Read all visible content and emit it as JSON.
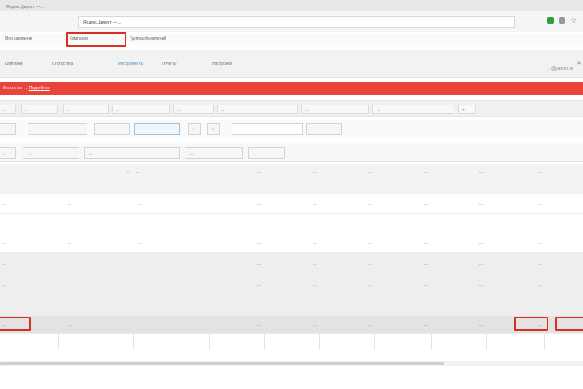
{
  "browser": {
    "tab_title": "Яндекс.Директ — ...",
    "address": "Яндекс.Директ — ...",
    "icons": [
      "secure-icon",
      "extension-icon",
      "bookmark-star-icon"
    ]
  },
  "breadcrumbs": {
    "items": [
      "Мои кампании",
      "Кампания",
      "Группа объявлений"
    ]
  },
  "nav": {
    "items": [
      "Кампании",
      "Статистика",
      "Инструменты",
      "Отчёты",
      "Настройки"
    ],
    "active_index": 2,
    "account_line1": "...",
    "account_line2": "...@yandex.ru"
  },
  "notice": {
    "text": "Внимание: ...",
    "link": "Подробнее"
  },
  "subtabs": [
    "...",
    "...",
    "...",
    "...",
    "...",
    "...",
    "...",
    "...",
    "...",
    "...",
    "...",
    "+"
  ],
  "filters": {
    "items": [
      "...",
      "...",
      "...",
      "...",
      "..."
    ],
    "search_placeholder": "",
    "apply_label": "..."
  },
  "segments": [
    "...",
    "...",
    "...",
    "...",
    "..."
  ],
  "table": {
    "headers": [
      "",
      "...",
      "...",
      "...",
      "...",
      "...",
      "...",
      "...",
      "...",
      "...",
      "..."
    ],
    "rows": [
      {
        "type": "white",
        "cells": [
          "...",
          "...",
          "...",
          "...",
          "...",
          "...",
          "...",
          "...",
          "...",
          "...",
          "..."
        ]
      },
      {
        "type": "white",
        "cells": [
          "...",
          "...",
          "...",
          "...",
          "...",
          "...",
          "...",
          "...",
          "...",
          "...",
          "..."
        ]
      },
      {
        "type": "white",
        "cells": [
          "...",
          "...",
          "...",
          "...",
          "...",
          "...",
          "...",
          "...",
          "...",
          "...",
          "..."
        ]
      },
      {
        "type": "grey",
        "cells": [
          "...",
          "",
          "",
          "...",
          "...",
          "...",
          "...",
          "...",
          "...",
          "...",
          "..."
        ]
      },
      {
        "type": "grey",
        "cells": [
          "...",
          "",
          "",
          "...",
          "...",
          "...",
          "...",
          "...",
          "...",
          "...",
          "..."
        ]
      },
      {
        "type": "grey",
        "cells": [
          "...",
          "",
          "",
          "...",
          "...",
          "...",
          "...",
          "...",
          "...",
          "...",
          "..."
        ]
      },
      {
        "type": "total",
        "cells": [
          "...",
          "...",
          "",
          "...",
          "...",
          "...",
          "...",
          "...",
          "...",
          "...",
          "..."
        ]
      }
    ]
  },
  "colors": {
    "notice_bg": "#e8443a",
    "highlight": "#d93025",
    "link": "#2a6fb5",
    "active_nav": "#4a90c0"
  }
}
